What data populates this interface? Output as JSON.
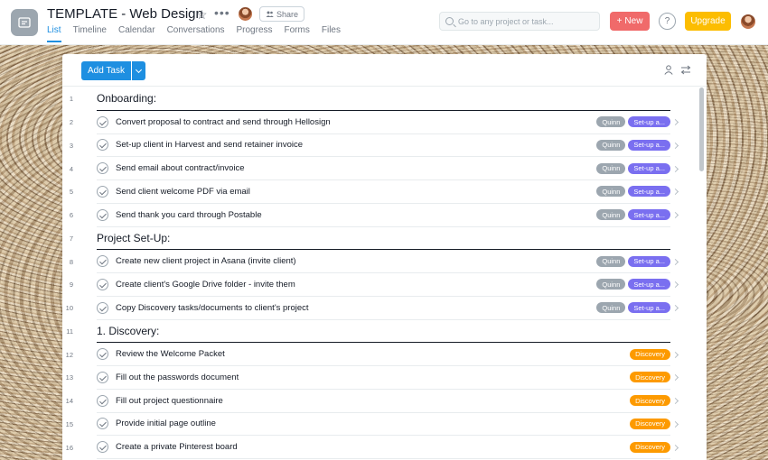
{
  "header": {
    "project_title": "TEMPLATE - Web Design",
    "share_label": "Share",
    "tabs": [
      {
        "label": "List",
        "active": true
      },
      {
        "label": "Timeline"
      },
      {
        "label": "Calendar"
      },
      {
        "label": "Conversations"
      },
      {
        "label": "Progress"
      },
      {
        "label": "Forms"
      },
      {
        "label": "Files"
      }
    ],
    "search_placeholder": "Go to any project or task...",
    "new_label": "New",
    "help_label": "?",
    "upgrade_label": "Upgrade"
  },
  "toolbar": {
    "add_task_label": "Add Task"
  },
  "rows": [
    {
      "num": "1",
      "type": "section",
      "title": "Onboarding:"
    },
    {
      "num": "2",
      "type": "task",
      "name": "Convert proposal to contract and send through Hellosign",
      "tags": [
        {
          "label": "Quinn",
          "color": "gray"
        },
        {
          "label": "Set-up a...",
          "color": "purple"
        }
      ]
    },
    {
      "num": "3",
      "type": "task",
      "name": "Set-up client in Harvest and send retainer invoice",
      "tags": [
        {
          "label": "Quinn",
          "color": "gray"
        },
        {
          "label": "Set-up a...",
          "color": "purple"
        }
      ]
    },
    {
      "num": "4",
      "type": "task",
      "name": "Send email about contract/invoice",
      "tags": [
        {
          "label": "Quinn",
          "color": "gray"
        },
        {
          "label": "Set-up a...",
          "color": "purple"
        }
      ]
    },
    {
      "num": "5",
      "type": "task",
      "name": "Send client welcome PDF via email",
      "tags": [
        {
          "label": "Quinn",
          "color": "gray"
        },
        {
          "label": "Set-up a...",
          "color": "purple"
        }
      ]
    },
    {
      "num": "6",
      "type": "task",
      "name": "Send thank you card through Postable",
      "tags": [
        {
          "label": "Quinn",
          "color": "gray"
        },
        {
          "label": "Set-up a...",
          "color": "purple"
        }
      ]
    },
    {
      "num": "7",
      "type": "section",
      "title": "Project Set-Up:"
    },
    {
      "num": "8",
      "type": "task",
      "name": "Create new client project in Asana (invite client)",
      "tags": [
        {
          "label": "Quinn",
          "color": "gray"
        },
        {
          "label": "Set-up a...",
          "color": "purple"
        }
      ]
    },
    {
      "num": "9",
      "type": "task",
      "name": "Create client's Google Drive folder - invite them",
      "tags": [
        {
          "label": "Quinn",
          "color": "gray"
        },
        {
          "label": "Set-up a...",
          "color": "purple"
        }
      ]
    },
    {
      "num": "10",
      "type": "task",
      "name": "Copy Discovery tasks/documents to client's project",
      "tags": [
        {
          "label": "Quinn",
          "color": "gray"
        },
        {
          "label": "Set-up a...",
          "color": "purple"
        }
      ]
    },
    {
      "num": "11",
      "type": "section",
      "title": "1. Discovery:"
    },
    {
      "num": "12",
      "type": "task",
      "name": "Review the Welcome Packet",
      "tags": [
        {
          "label": "Discovery",
          "color": "orange"
        }
      ]
    },
    {
      "num": "13",
      "type": "task",
      "name": "Fill out the passwords document",
      "tags": [
        {
          "label": "Discovery",
          "color": "orange"
        }
      ]
    },
    {
      "num": "14",
      "type": "task",
      "name": "Fill out project questionnaire",
      "tags": [
        {
          "label": "Discovery",
          "color": "orange"
        }
      ]
    },
    {
      "num": "15",
      "type": "task",
      "name": "Provide initial page outline",
      "tags": [
        {
          "label": "Discovery",
          "color": "orange"
        }
      ]
    },
    {
      "num": "16",
      "type": "task",
      "name": "Create a private Pinterest board",
      "tags": [
        {
          "label": "Discovery",
          "color": "orange"
        }
      ]
    }
  ],
  "colors": {
    "accent": "#1e8fe1",
    "new": "#f06a6a",
    "upgrade": "#fcbd01",
    "purple_tag": "#7a6ff0",
    "orange_tag": "#fd9a00",
    "gray_tag": "#9ca6af"
  }
}
